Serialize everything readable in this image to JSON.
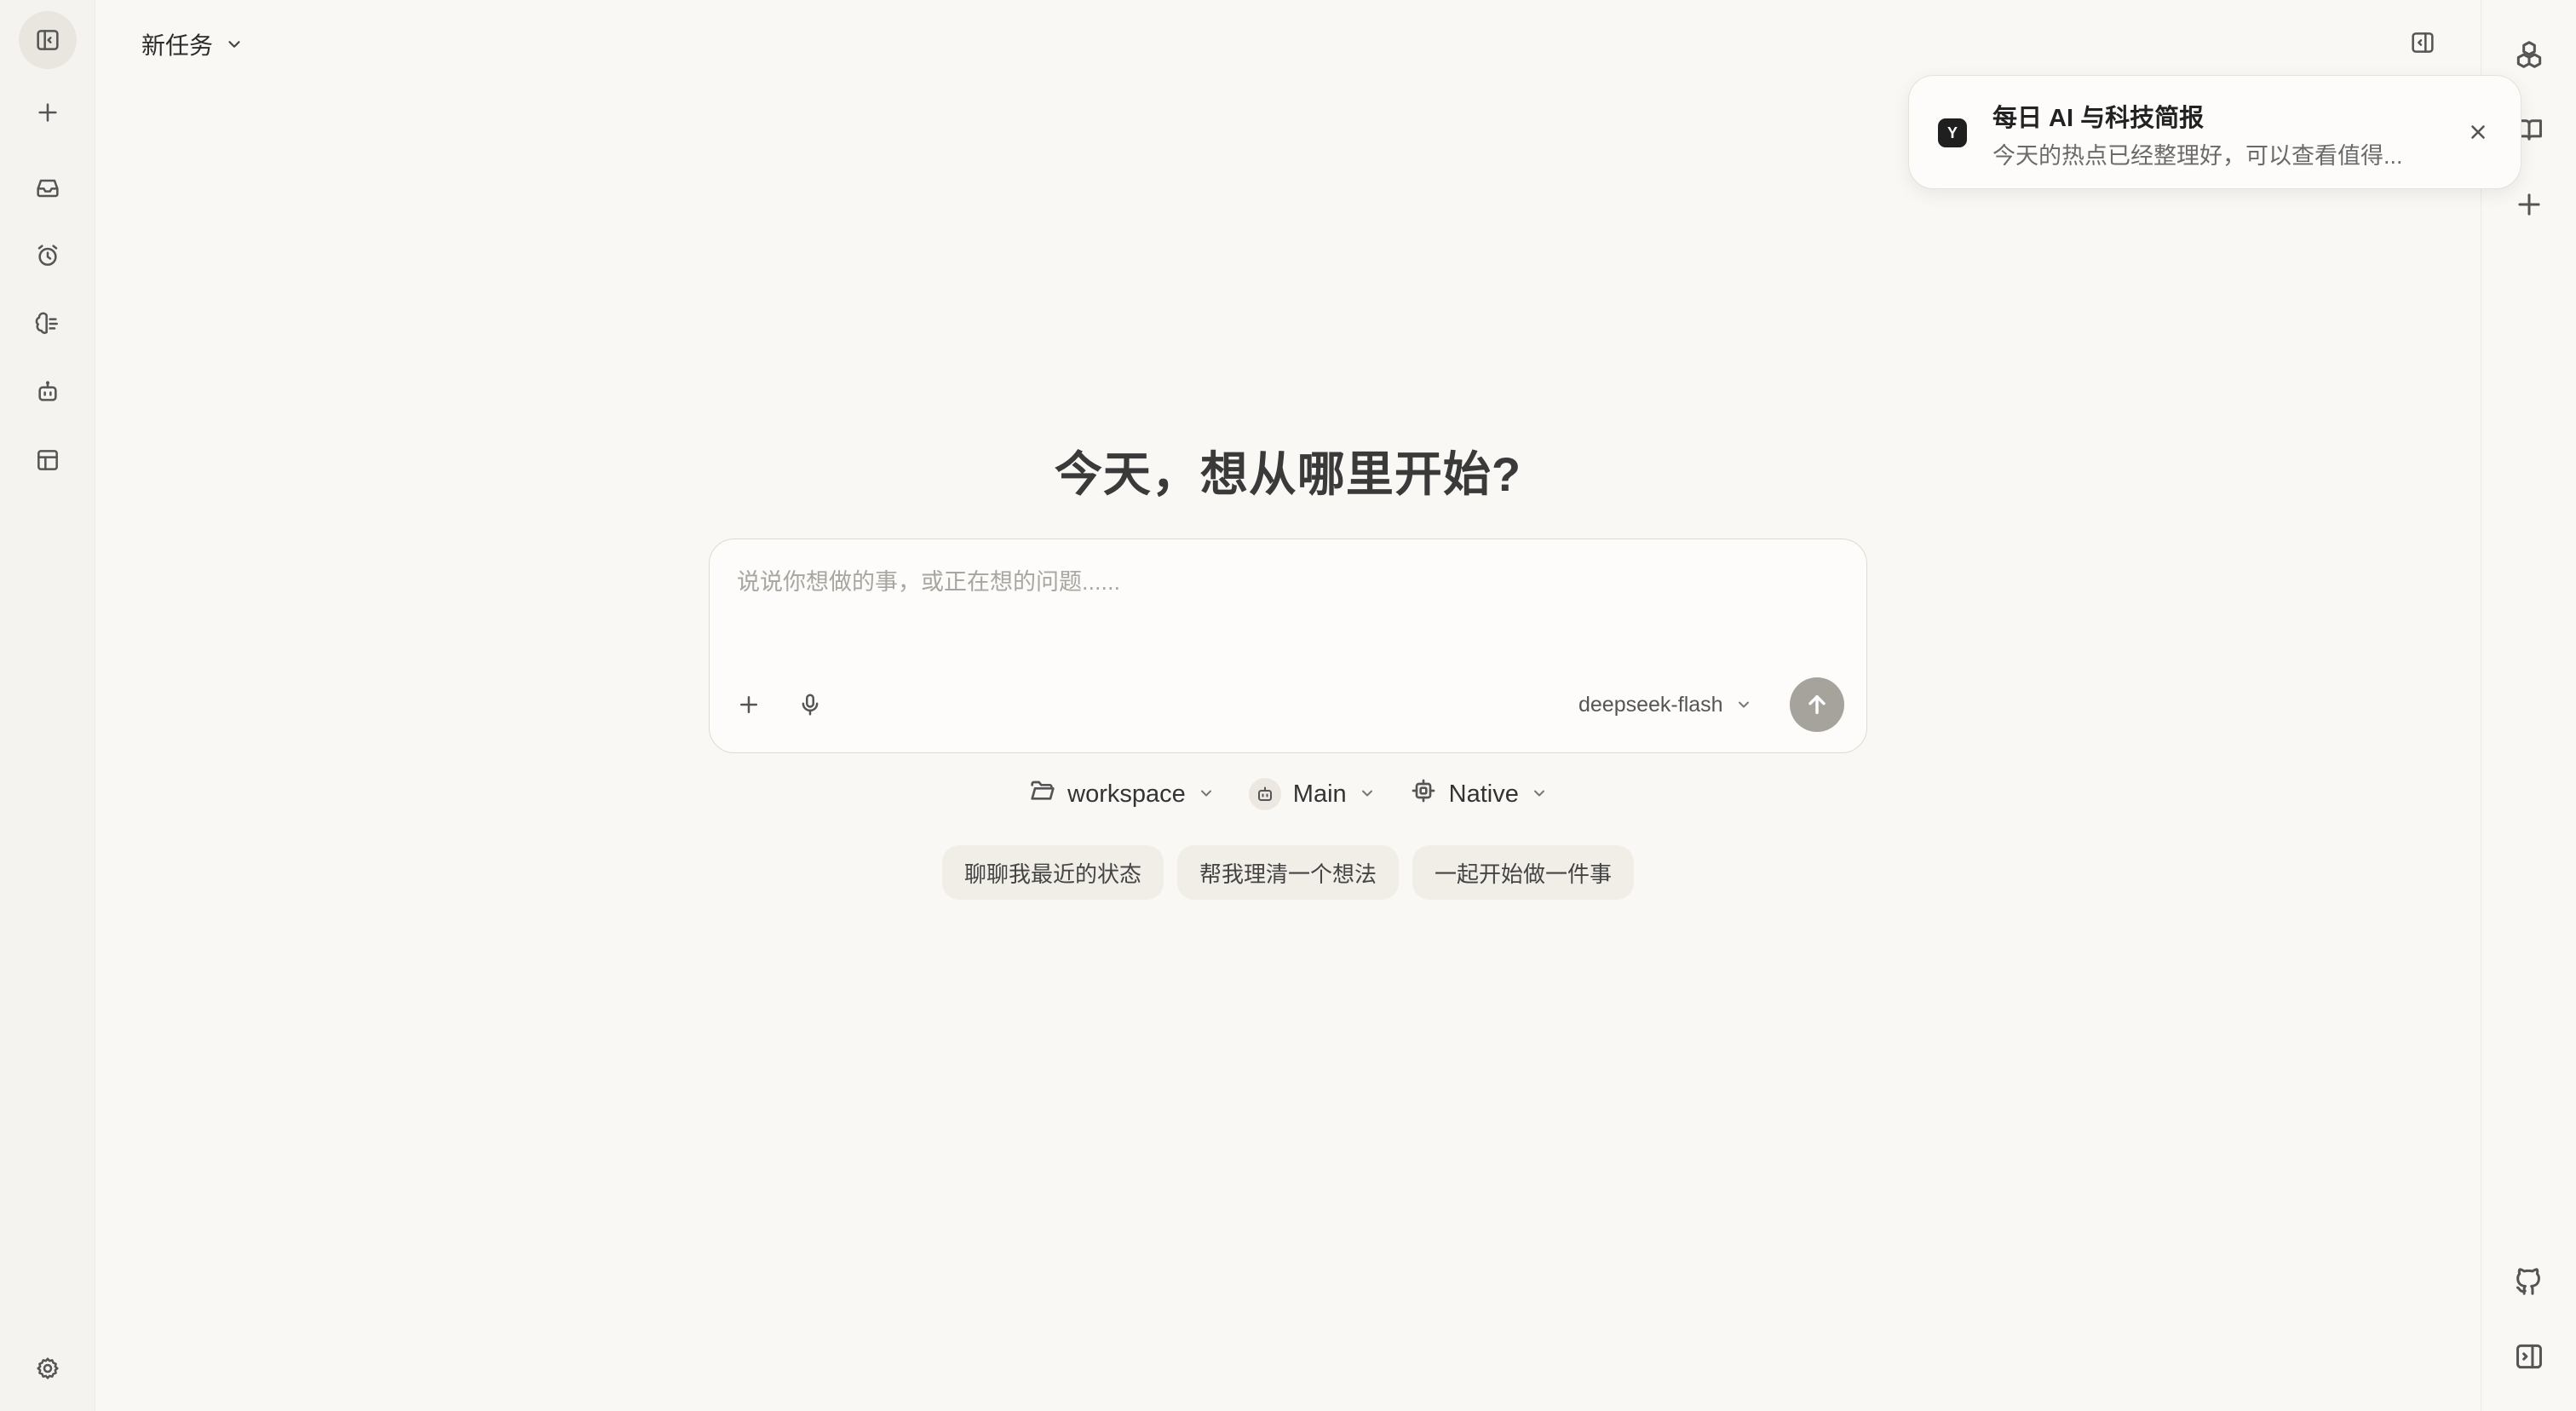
{
  "header": {
    "task_title": "新任务"
  },
  "notification": {
    "badge": "Y",
    "title": "每日 AI 与科技简报",
    "body": "今天的热点已经整理好，可以查看值得..."
  },
  "main": {
    "heading": "今天，想从哪里开始?",
    "composer": {
      "placeholder": "说说你想做的事，或正在想的问题......",
      "value": "",
      "model": "deepseek-flash"
    },
    "selectors": {
      "folder": "workspace",
      "agent": "Main",
      "runtime": "Native"
    },
    "suggestions": [
      "聊聊我最近的状态",
      "帮我理清一个想法",
      "一起开始做一件事"
    ]
  },
  "icons": {
    "left_sidebar": [
      "sidebar-toggle-icon",
      "plus-icon",
      "inbox-icon",
      "alarm-clock-icon",
      "brain-icon",
      "robot-icon",
      "layout-icon",
      "gear-icon"
    ],
    "right_sidebar": [
      "cubes-icon",
      "book-icon",
      "plus-icon",
      "github-icon",
      "panel-right-icon"
    ]
  },
  "colors": {
    "background": "#faf8f4",
    "sidebar": "#f5f3ef",
    "send_button": "#a6a39d",
    "chip": "#f1eee8"
  }
}
